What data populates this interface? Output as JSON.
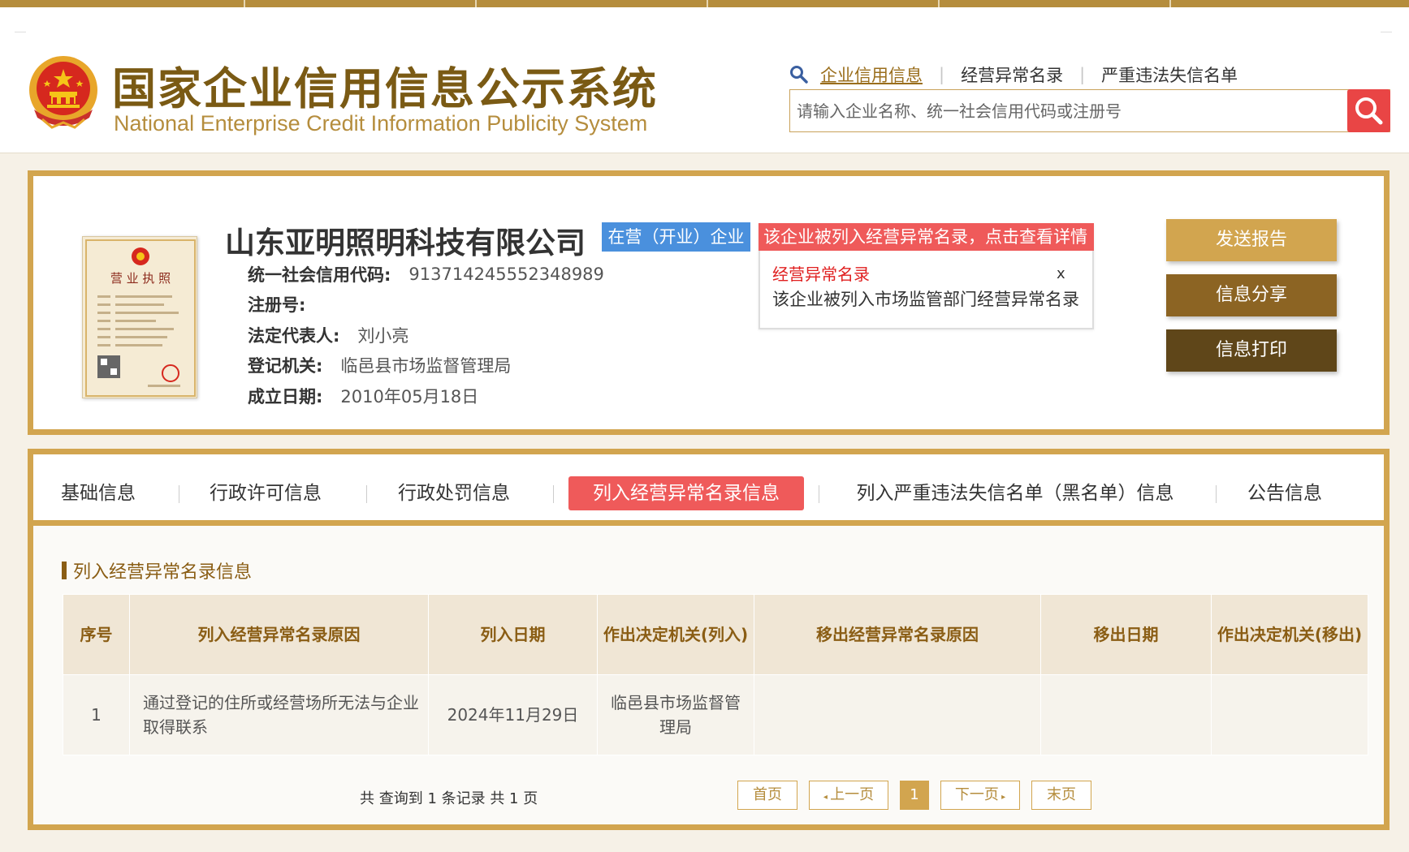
{
  "header": {
    "title_cn": "国家企业信用信息公示系统",
    "title_en": "National Enterprise Credit Information Publicity System",
    "nav_links": [
      "企业信用信息",
      "经营异常名录",
      "严重违法失信名单"
    ],
    "search_placeholder": "请输入企业名称、统一社会信用代码或注册号"
  },
  "company": {
    "name": "山东亚明照明科技有限公司",
    "status": "在营（开业）企业",
    "fields": [
      {
        "label": "统一社会信用代码:",
        "value": "913714245552348989"
      },
      {
        "label": "注册号:",
        "value": ""
      },
      {
        "label": "法定代表人:",
        "value": "刘小亮"
      },
      {
        "label": "登记机关:",
        "value": "临邑县市场监督管理局"
      },
      {
        "label": "成立日期:",
        "value": "2010年05月18日"
      }
    ],
    "license_label": "营 业 执 照"
  },
  "alert": {
    "header": "该企业被列入经营异常名录，点击查看详情",
    "title": "经营异常名录",
    "close": "x",
    "text": "该企业被列入市场监管部门经营异常名录"
  },
  "actions": [
    "发送报告",
    "信息分享",
    "信息打印"
  ],
  "tabs": [
    "基础信息",
    "行政许可信息",
    "行政处罚信息",
    "列入经营异常名录信息",
    "列入严重违法失信名单（黑名单）信息",
    "公告信息"
  ],
  "active_tab": "列入经营异常名录信息",
  "section_title": "列入经营异常名录信息",
  "table": {
    "headers": [
      "序号",
      "列入经营异常名录原因",
      "列入日期",
      "作出决定机关(列入)",
      "移出经营异常名录原因",
      "移出日期",
      "作出决定机关(移出)"
    ],
    "rows": [
      [
        "1",
        "通过登记的住所或经营场所无法与企业取得联系",
        "2024年11月29日",
        "临邑县市场监督管理局",
        "",
        "",
        ""
      ]
    ]
  },
  "pagination": {
    "info": "共 查询到 1 条记录 共 1 页",
    "first": "首页",
    "prev": "上一页",
    "current": "1",
    "next": "下一页",
    "last": "末页"
  },
  "colors": {
    "gold": "#d2a54f",
    "dark_gold": "#8a5d14",
    "red": "#ef5a5a",
    "blue": "#4a90dd",
    "brown": "#8c6423",
    "dark_brown": "#5f4619"
  }
}
